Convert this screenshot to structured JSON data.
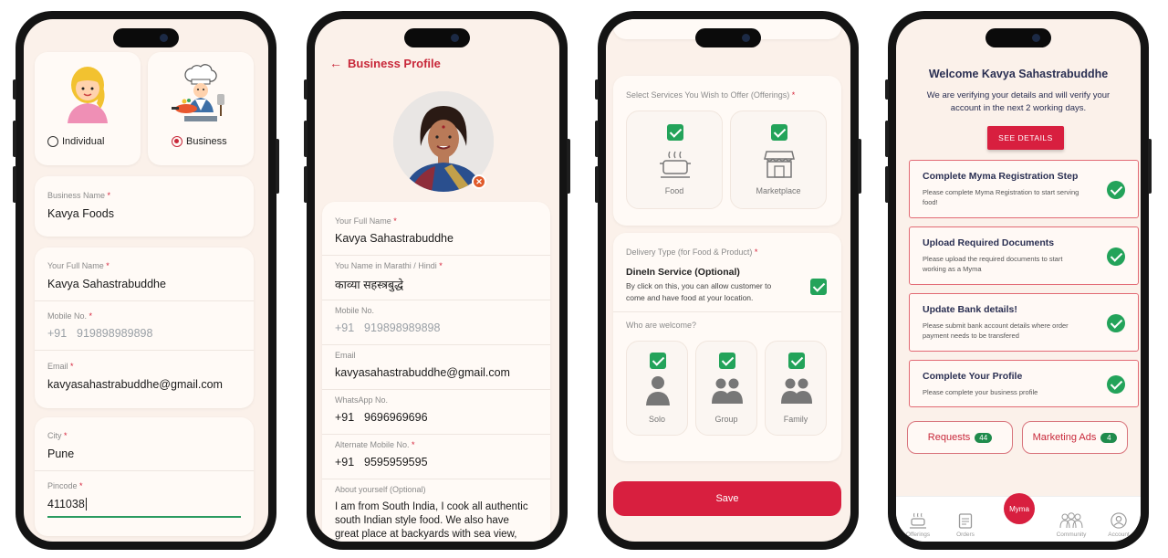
{
  "screen1": {
    "account_types": [
      {
        "label": "Individual",
        "selected": false
      },
      {
        "label": "Business",
        "selected": true
      }
    ],
    "business_name": {
      "label": "Business Name",
      "value": "Kavya Foods"
    },
    "full_name": {
      "label": "Your Full Name",
      "value": "Kavya Sahastrabuddhe"
    },
    "mobile": {
      "label": "Mobile No.",
      "prefix": "+91",
      "value": "919898989898"
    },
    "email": {
      "label": "Email",
      "value": "kavyasahastrabuddhe@gmail.com"
    },
    "city": {
      "label": "City",
      "value": "Pune"
    },
    "pincode": {
      "label": "Pincode",
      "value": "411038"
    }
  },
  "screen2": {
    "title": "Business Profile",
    "fields": [
      {
        "label": "Your Full Name",
        "required": true,
        "prefix": "",
        "value": "Kavya Sahastrabuddhe",
        "muted": false
      },
      {
        "label": "You Name in Marathi / Hindi",
        "required": true,
        "prefix": "",
        "value": "काव्या सहस्त्रबुद्धे",
        "muted": false
      },
      {
        "label": "Mobile No.",
        "required": false,
        "prefix": "+91",
        "value": "919898989898",
        "muted": true
      },
      {
        "label": "Email",
        "required": false,
        "prefix": "",
        "value": "kavyasahastrabuddhe@gmail.com",
        "muted": false
      },
      {
        "label": "WhatsApp No.",
        "required": false,
        "prefix": "+91",
        "value": "9696969696",
        "muted": false
      },
      {
        "label": "Alternate Mobile No.",
        "required": true,
        "prefix": "+91",
        "value": "9595959595",
        "muted": false
      }
    ],
    "about": {
      "label": "About yourself (Optional)",
      "value": "I am from South India, I cook all authentic south Indian style food. We also have great place at backyards with sea view,"
    }
  },
  "screen3": {
    "services_label": "Select Services You Wish to Offer (Offerings)",
    "services": [
      {
        "label": "Food",
        "icon": "food-pot-icon"
      },
      {
        "label": "Marketplace",
        "icon": "marketplace-icon"
      }
    ],
    "delivery_label": "Delivery Type (for Food & Product)",
    "dinein": {
      "title": "DineIn Service (Optional)",
      "desc": "By click on this, you can allow customer to come and have food at your location."
    },
    "welcome_label": "Who are welcome?",
    "welcome": [
      {
        "label": "Solo",
        "icon": "person-icon"
      },
      {
        "label": "Group",
        "icon": "group-icon"
      },
      {
        "label": "Family",
        "icon": "family-icon"
      }
    ],
    "save": "Save"
  },
  "screen4": {
    "title": "Welcome Kavya Sahastrabuddhe",
    "subtitle": "We are verifying your details and will verify your account in the next 2 working days.",
    "see_details": "SEE DETAILS",
    "steps": [
      {
        "title": "Complete Myma Registration Step",
        "desc": "Please complete Myma Registration to start serving food!"
      },
      {
        "title": "Upload Required Documents",
        "desc": "Please upload the required documents to start working as a Myma"
      },
      {
        "title": "Update Bank details!",
        "desc": "Please submit bank account details where order payment needs to be transfered"
      },
      {
        "title": "Complete Your Profile",
        "desc": "Please complete your business profile"
      }
    ],
    "requests": {
      "label": "Requests",
      "count": "44"
    },
    "marketing": {
      "label": "Marketing Ads",
      "count": "4"
    },
    "nav": [
      {
        "label": "Offerings",
        "icon": "offerings-icon"
      },
      {
        "label": "Orders",
        "icon": "orders-icon"
      },
      {
        "label": "Myma",
        "icon": "myma-logo"
      },
      {
        "label": "Community",
        "icon": "community-icon"
      },
      {
        "label": "Account",
        "icon": "account-icon"
      }
    ]
  },
  "colors": {
    "brand_red": "#c8283a",
    "check_green": "#23a35a",
    "screen_bg": "#fbf1ea"
  }
}
